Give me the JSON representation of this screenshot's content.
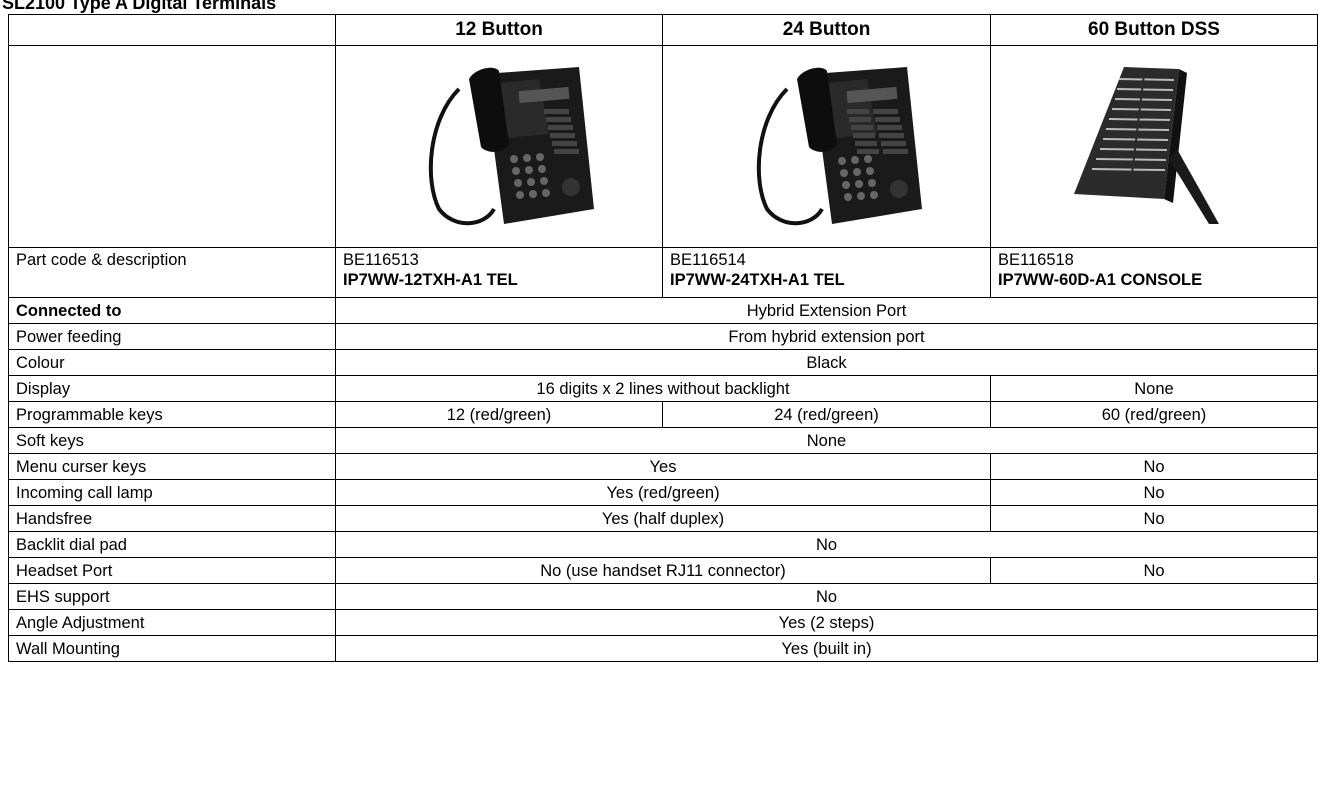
{
  "title": "SL2100 Type A Digital Terminals",
  "columns": [
    "12 Button",
    "24 Button",
    "60 Button DSS"
  ],
  "products": [
    {
      "code": "BE116513",
      "description": "IP7WW-12TXH-A1 TEL",
      "image_icon": "digital-telephone-12-button"
    },
    {
      "code": "BE116514",
      "description": "IP7WW-24TXH-A1 TEL",
      "image_icon": "digital-telephone-24-button"
    },
    {
      "code": "BE116518",
      "description": "IP7WW-60D-A1 CONSOLE",
      "image_icon": "dss-console-60-button"
    }
  ],
  "rows": {
    "part_code": "Part code & description",
    "connected_to": {
      "label": "Connected to",
      "value": "Hybrid Extension Port"
    },
    "power_feeding": {
      "label": "Power feeding",
      "value": "From hybrid extension port"
    },
    "colour": {
      "label": "Colour",
      "value": "Black"
    },
    "display": {
      "label": "Display",
      "phones": "16 digits x 2 lines without backlight",
      "dss": "None"
    },
    "programmable_keys": {
      "label": "Programmable keys",
      "values": [
        "12 (red/green)",
        "24 (red/green)",
        "60 (red/green)"
      ]
    },
    "soft_keys": {
      "label": "Soft keys",
      "value": "None"
    },
    "menu_curser_keys": {
      "label": "Menu curser keys",
      "phones": "Yes",
      "dss": "No"
    },
    "incoming_call_lamp": {
      "label": "Incoming call lamp",
      "phones": "Yes (red/green)",
      "dss": "No"
    },
    "handsfree": {
      "label": "Handsfree",
      "phones": "Yes (half duplex)",
      "dss": "No"
    },
    "backlit_dial_pad": {
      "label": "Backlit dial pad",
      "value": "No"
    },
    "headset_port": {
      "label": "Headset Port",
      "phones": "No (use handset RJ11 connector)",
      "dss": "No"
    },
    "ehs_support": {
      "label": "EHS support",
      "value": "No"
    },
    "angle_adjustment": {
      "label": "Angle Adjustment",
      "value": "Yes (2 steps)"
    },
    "wall_mounting": {
      "label": "Wall Mounting",
      "value": "Yes (built in)"
    }
  }
}
